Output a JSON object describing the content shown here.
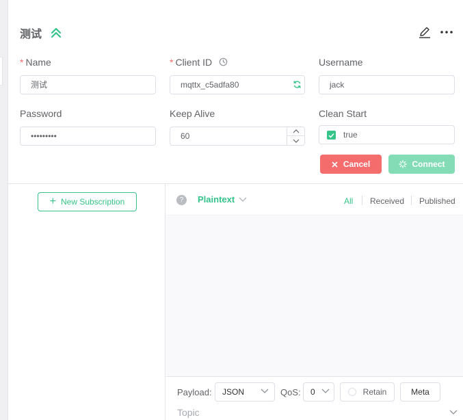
{
  "connection": {
    "name": "测试"
  },
  "form": {
    "name": {
      "label": "Name",
      "required": "*",
      "value": "测试"
    },
    "client_id": {
      "label": "Client ID",
      "required": "*",
      "value": "mqttx_c5adfa80"
    },
    "username": {
      "label": "Username",
      "value": "jack"
    },
    "password": {
      "label": "Password",
      "value": "•••••••••"
    },
    "keep_alive": {
      "label": "Keep Alive",
      "value": "60"
    },
    "clean_start": {
      "label": "Clean Start",
      "value": "true",
      "checked": true
    }
  },
  "actions": {
    "cancel_label": "Cancel",
    "connect_label": "Connect"
  },
  "subscriptions": {
    "new_label": "New Subscription"
  },
  "messages": {
    "format": "Plaintext",
    "filters": [
      "All",
      "Received",
      "Published"
    ],
    "active_filter": "All"
  },
  "composer": {
    "payload_label": "Payload:",
    "payload_format": "JSON",
    "qos_label": "QoS:",
    "qos_value": "0",
    "retain_label": "Retain",
    "meta_label": "Meta",
    "topic_placeholder": "Topic"
  },
  "colors": {
    "accent": "#34c388",
    "danger": "#f56c6c",
    "connect_disabled": "#84dcb7"
  }
}
